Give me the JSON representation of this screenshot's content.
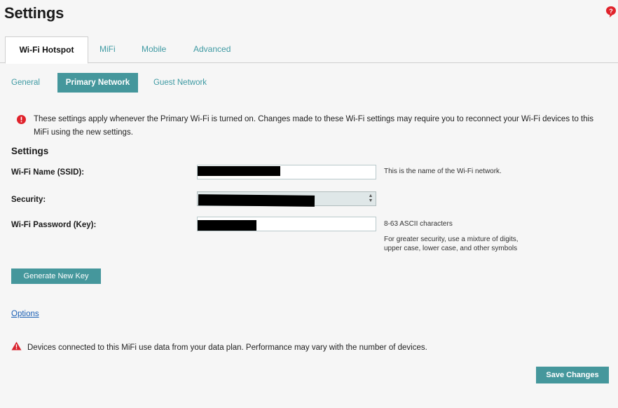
{
  "page": {
    "title": "Settings"
  },
  "icons": {
    "help": "help-icon",
    "info": "info-icon",
    "warning": "warning-icon"
  },
  "colors": {
    "accent": "#45979c",
    "link": "#3f9aa3",
    "info_red": "#e0222b",
    "warning_red": "#d9232e",
    "options_link": "#1a5fb4"
  },
  "tabs": [
    {
      "label": "Wi-Fi Hotspot",
      "active": true
    },
    {
      "label": "MiFi",
      "active": false
    },
    {
      "label": "Mobile",
      "active": false
    },
    {
      "label": "Advanced",
      "active": false
    }
  ],
  "subtabs": [
    {
      "label": "General",
      "active": false
    },
    {
      "label": "Primary Network",
      "active": true
    },
    {
      "label": "Guest Network",
      "active": false
    }
  ],
  "info_message": "These settings apply whenever the Primary Wi-Fi is turned on. Changes made to these Wi-Fi settings may require you to reconnect your Wi-Fi devices to this MiFi using the new settings.",
  "form": {
    "section_title": "Settings",
    "ssid": {
      "label": "Wi-Fi Name (SSID):",
      "hint": "This is the name of the Wi-Fi network."
    },
    "security": {
      "label": "Security:"
    },
    "password": {
      "label": "Wi-Fi Password (Key):",
      "hint_line1": "8-63 ASCII characters",
      "hint_line2": "For greater security, use a mixture of digits,",
      "hint_line3": "upper case, lower case, and other symbols"
    },
    "generate_button": "Generate New Key",
    "options_link": "Options"
  },
  "warning_message": "Devices connected to this MiFi use data from your data plan. Performance may vary with the number of devices.",
  "save_button": "Save Changes"
}
